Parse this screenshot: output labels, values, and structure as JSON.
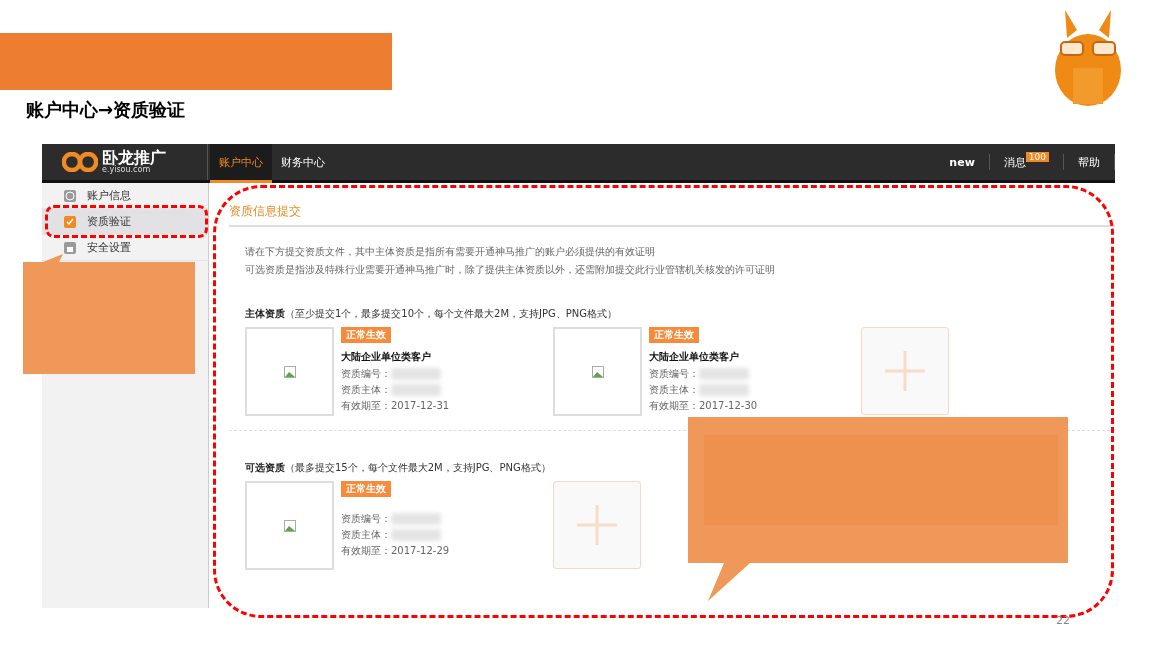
{
  "slide": {
    "title": "账户中心→资质验证",
    "page_number": "22"
  },
  "app": {
    "logo": {
      "name": "卧龙推广",
      "domain": "e.yisou.com"
    },
    "tabs": [
      {
        "label": "账户中心",
        "selected": true
      },
      {
        "label": "财务中心",
        "selected": false
      }
    ],
    "nav_right": [
      {
        "label": "new",
        "kind": "plain"
      },
      {
        "label": "消息",
        "kind": "badge",
        "badge": "100"
      },
      {
        "label": "帮助",
        "kind": "plain"
      }
    ],
    "sidebar": {
      "items": [
        {
          "label": "账户信息",
          "selected": false
        },
        {
          "label": "资质验证",
          "selected": true
        },
        {
          "label": "安全设置",
          "selected": false
        }
      ]
    },
    "main": {
      "title": "资质信息提交",
      "description": [
        "请在下方提交资质文件，其中主体资质是指所有需要开通神马推广的账户必须提供的有效证明",
        "可选资质是指涉及特殊行业需要开通神马推广时，除了提供主体资质以外，还需附加提交此行业管辖机关核发的许可证明"
      ],
      "sections": [
        {
          "heading": "主体资质",
          "note": "（至少提交1个，最多提交10个，每个文件最大2M，支持JPG、PNG格式）",
          "cards": [
            {
              "status": "正常生效",
              "title": "大陆企业单位类客户",
              "fields": [
                {
                  "label": "资质编号："
                },
                {
                  "label": "资质主体："
                },
                {
                  "label": "有效期至：",
                  "value": "2017-12-31"
                }
              ]
            },
            {
              "status": "正常生效",
              "title": "大陆企业单位类客户",
              "fields": [
                {
                  "label": "资质编号："
                },
                {
                  "label": "资质主体："
                },
                {
                  "label": "有效期至：",
                  "value": "2017-12-30"
                }
              ]
            }
          ]
        },
        {
          "heading": "可选资质",
          "note": "（最多提交15个，每个文件最大2M，支持JPG、PNG格式）",
          "cards": [
            {
              "status": "正常生效",
              "fields": [
                {
                  "label": "资质编号："
                },
                {
                  "label": "资质主体："
                },
                {
                  "label": "有效期至：",
                  "value": "2017-12-29"
                }
              ]
            }
          ]
        }
      ]
    }
  }
}
